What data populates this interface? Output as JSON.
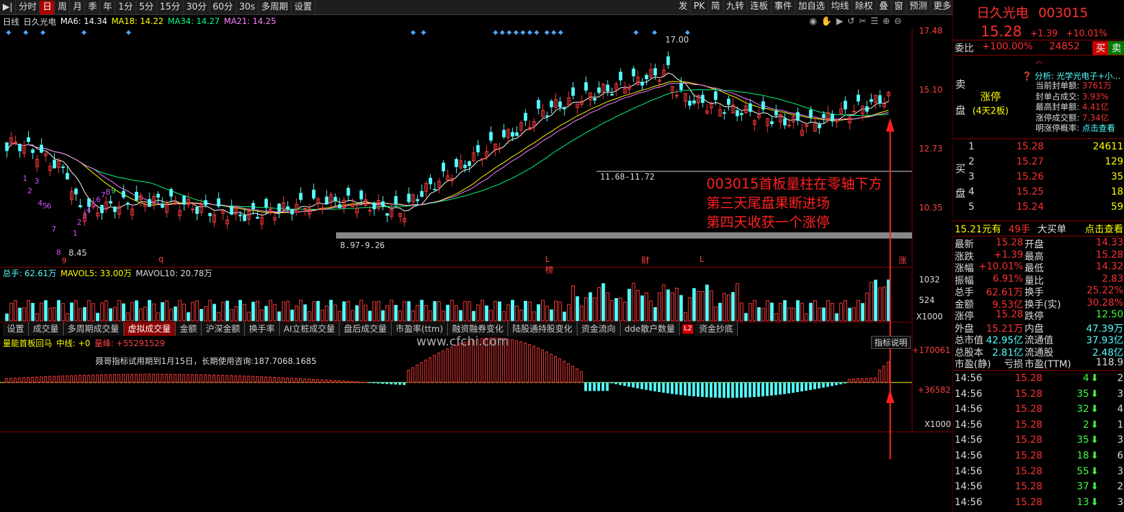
{
  "toolbar": {
    "left": [
      "分时",
      "日",
      "周",
      "月",
      "季",
      "年",
      "1分",
      "5分",
      "15分",
      "30分",
      "60分",
      "30s",
      "多周期",
      "设置"
    ],
    "active_index": 1,
    "right": [
      "发",
      "PK",
      "简",
      "九转",
      "连板",
      "事件",
      "加自选",
      "均线",
      "除权",
      "叠",
      "窗",
      "预测",
      "更多"
    ]
  },
  "chart_header": {
    "period": "日线",
    "name": "日久光电",
    "ma6": "MA6: 14.34",
    "ma18": "MA18: 14.22",
    "ma34": "MA34: 14.27",
    "ma21": "MA21: 14.25"
  },
  "price_axis": [
    "17.48",
    "15.10",
    "12.73",
    "10.35"
  ],
  "annotations": {
    "high_label": "17.00",
    "low_label": "8.45",
    "range1": "11.68-11.72",
    "range2": "8.97-9.26",
    "note_lines": [
      "003015首板量柱在零轴下方",
      "第三天尾盘果断进场",
      "第四天收获一个涨停"
    ],
    "markers": [
      "9",
      "q",
      "L榜",
      "财",
      "L",
      "涨"
    ],
    "seq_nums": [
      "1",
      "2",
      "3",
      "4",
      "5",
      "6",
      "7",
      "8",
      "9",
      "4",
      "5",
      "6",
      "7",
      "8",
      "1",
      "2",
      "3",
      "4",
      "5",
      "6",
      "7",
      "8",
      "9"
    ]
  },
  "volume_header": {
    "total": "总手: 62.61万",
    "mavol5": "MAVOL5: 33.00万",
    "mavol10": "MAVOL10: 20.78万"
  },
  "volume_axis": [
    "1032",
    "524",
    "X1000"
  ],
  "tabs": [
    "设置",
    "成交量",
    "多周期成交量",
    "虚拟成交量",
    "金额",
    "沪深金额",
    "换手率",
    "AI立桩成交量",
    "盘后成交量",
    "市盈率(ttm)",
    "融资融券变化",
    "陆股通持股变化",
    "资金流向",
    "dde散户数量",
    "资金抄底"
  ],
  "tabs_badge": "L2",
  "active_tab": 3,
  "indicator": {
    "name": "量能首板回马",
    "mid": "中线: +0",
    "peak": "量峰: +55291529",
    "help": "指标说明",
    "notice": "聂哥指标试用期到1月15日，长期使用咨询:187.7068.1685",
    "axis": [
      "+170061",
      "+36582",
      "X1000"
    ],
    "watermark": "www.cfchi.com"
  },
  "stock": {
    "name": "日久光电",
    "code": "003015",
    "price": "15.28",
    "change": "+1.39",
    "pct": "+10.01%",
    "weibi_label": "委比",
    "weibi": "+100.00%",
    "weicha": "24852",
    "buy_btn": "买",
    "sell_btn": "卖",
    "sell_side": [
      "卖",
      "盘"
    ],
    "buy_side": [
      "买",
      "盘"
    ],
    "limit_title": "涨停",
    "limit_sub": "(4天2板)",
    "analysis": "分析: 光学光电子+小...",
    "limit_info": [
      [
        "当前封单额:",
        "3761万"
      ],
      [
        "封单占成交:",
        "3.93%"
      ],
      [
        "最高封单额:",
        "4.41亿"
      ],
      [
        "涨停成交额:",
        "7.34亿"
      ],
      [
        "明涨停概率:",
        "点击查看"
      ]
    ],
    "bids": [
      [
        "1",
        "15.28",
        "24611"
      ],
      [
        "2",
        "15.27",
        "129"
      ],
      [
        "3",
        "15.26",
        "35"
      ],
      [
        "4",
        "15.25",
        "18"
      ],
      [
        "5",
        "15.24",
        "59"
      ]
    ],
    "big_order": {
      "price": "15.21元有",
      "count": "49手",
      "label": "大买单",
      "link": "点击查看"
    },
    "stats": [
      [
        "最新",
        "15.28",
        "开盘",
        "14.33"
      ],
      [
        "涨跌",
        "+1.39",
        "最高",
        "15.28"
      ],
      [
        "涨幅",
        "+10.01%",
        "最低",
        "14.32"
      ],
      [
        "振幅",
        "6.91%",
        "量比",
        "2.83"
      ],
      [
        "总手",
        "62.61万",
        "换手",
        "25.22%"
      ],
      [
        "金额",
        "9.53亿",
        "换手(实)",
        "30.28%"
      ],
      [
        "涨停",
        "15.28",
        "跌停",
        "12.50"
      ],
      [
        "外盘",
        "15.21万",
        "内盘",
        "47.39万"
      ],
      [
        "总市值",
        "42.95亿",
        "流通值",
        "37.93亿"
      ],
      [
        "总股本",
        "2.81亿",
        "流通股",
        "2.48亿"
      ],
      [
        "市盈(静)",
        "亏损",
        "市盈(TTM)",
        "118.9"
      ]
    ],
    "ticks": [
      [
        "14:56",
        "15.28",
        "4",
        "2"
      ],
      [
        "14:56",
        "15.28",
        "35",
        "3"
      ],
      [
        "14:56",
        "15.28",
        "32",
        "4"
      ],
      [
        "14:56",
        "15.28",
        "2",
        "1"
      ],
      [
        "14:56",
        "15.28",
        "35",
        "3"
      ],
      [
        "14:56",
        "15.28",
        "18",
        "6"
      ],
      [
        "14:56",
        "15.28",
        "55",
        "3"
      ],
      [
        "14:56",
        "15.28",
        "37",
        "2"
      ],
      [
        "14:56",
        "15.28",
        "13",
        "3"
      ]
    ]
  },
  "colors": {
    "up": "#ff3b3b",
    "down": "#54ffff",
    "yellow": "#ffff00",
    "bg": "#000000"
  }
}
